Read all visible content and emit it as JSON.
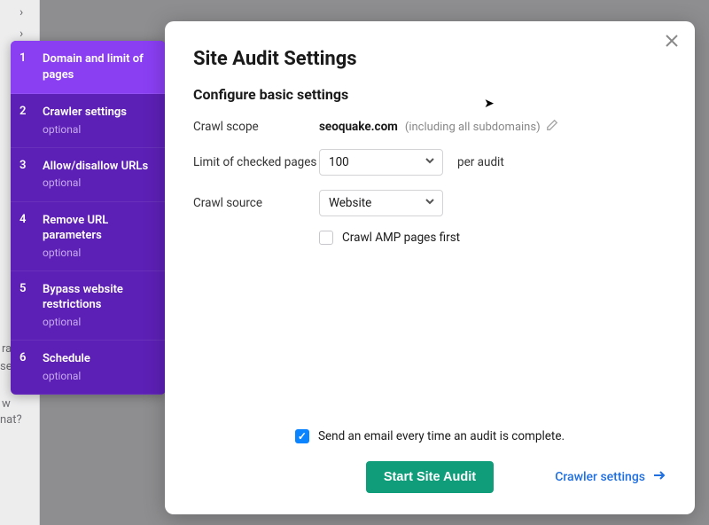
{
  "modal": {
    "title": "Site Audit Settings",
    "subtitle": "Configure basic settings",
    "close_label": "Close"
  },
  "fields": {
    "crawl_scope": {
      "label": "Crawl scope",
      "domain": "seoquake.com",
      "note": "(including all subdomains)"
    },
    "limit": {
      "label": "Limit of checked pages",
      "value": "100",
      "suffix": "per audit"
    },
    "source": {
      "label": "Crawl source",
      "value": "Website"
    },
    "amp": {
      "label": "Crawl AMP pages first",
      "checked": false
    }
  },
  "footer": {
    "email_label": "Send an email every time an audit is complete.",
    "email_checked": true,
    "primary": "Start Site Audit",
    "next": "Crawler settings"
  },
  "sidebar": {
    "steps": [
      {
        "num": "1",
        "title": "Domain and limit of pages",
        "optional": ""
      },
      {
        "num": "2",
        "title": "Crawler settings",
        "optional": "optional"
      },
      {
        "num": "3",
        "title": "Allow/disallow URLs",
        "optional": "optional"
      },
      {
        "num": "4",
        "title": "Remove URL parameters",
        "optional": "optional"
      },
      {
        "num": "5",
        "title": "Bypass website restrictions",
        "optional": "optional"
      },
      {
        "num": "6",
        "title": "Schedule",
        "optional": "optional"
      }
    ],
    "active_index": 0
  },
  "background": {
    "line1": "ram",
    "line2": "se or",
    "line3": "w",
    "line4": "nat?"
  }
}
